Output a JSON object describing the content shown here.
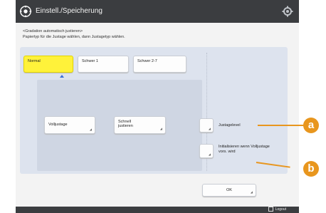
{
  "window": {
    "title": "Einstell./Speicherung"
  },
  "instructions": {
    "line1": "<Gradation automatisch justieren>",
    "line2": "Papiertyp für die Justage wählen, dann Justagetyp wählen."
  },
  "paper_types": [
    {
      "label": "Normal",
      "selected": true
    },
    {
      "label": "Schwer 1",
      "selected": false
    },
    {
      "label": "Schwer 2-7",
      "selected": false
    }
  ],
  "actions": {
    "full_adjust": "Volljustage",
    "quick_adjust": "Schnell justieren"
  },
  "side_options": {
    "target_level": "Justagelevel",
    "init_on_full": "Initialisieren wenn Volljustage vors. wird"
  },
  "ok_label": "OK",
  "footer": {
    "logout_label": "Logout"
  },
  "callouts": {
    "a": "a",
    "b": "b"
  },
  "colors": {
    "titlebar": "#3b3d40",
    "selected": "#fff23a",
    "callout": "#e8961e",
    "panel": "#dde3ee"
  },
  "icons": {
    "title": "gear-copier-icon",
    "settings": "gear-icon"
  }
}
